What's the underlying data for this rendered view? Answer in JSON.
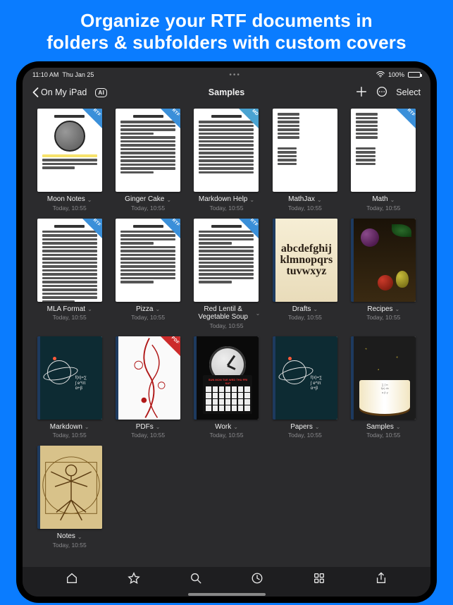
{
  "promo": {
    "line1": "Organize your RTF documents in",
    "line2": "folders & subfolders with custom covers"
  },
  "status": {
    "time": "11:10 AM",
    "date": "Thu Jan 25",
    "battery_pct": "100%"
  },
  "nav": {
    "back_label": "On My iPad",
    "ai_badge": "AI",
    "title": "Samples",
    "select_label": "Select"
  },
  "tags": {
    "rtf": "RTF",
    "md": "MD",
    "pdf": "PDF"
  },
  "items": [
    {
      "title": "Moon Notes",
      "subtitle": "Today, 10:55",
      "tag": "rtf",
      "thumb": "moon"
    },
    {
      "title": "Ginger Cake",
      "subtitle": "Today, 10:55",
      "tag": "rtf",
      "thumb": "form"
    },
    {
      "title": "Markdown Help",
      "subtitle": "Today, 10:55",
      "tag": "md",
      "thumb": "text"
    },
    {
      "title": "MathJax",
      "subtitle": "Today, 10:55",
      "tag": null,
      "thumb": "sparse"
    },
    {
      "title": "Math",
      "subtitle": "Today, 10:55",
      "tag": "rtf",
      "thumb": "sparse"
    },
    {
      "title": "MLA Format",
      "subtitle": "Today, 10:55",
      "tag": "rtf",
      "thumb": "dense"
    },
    {
      "title": "Pizza",
      "subtitle": "Today, 10:55",
      "tag": "rtf",
      "thumb": "form"
    },
    {
      "title": "Red Lentil & Vegetable Soup",
      "subtitle": "Today, 10:55",
      "tag": "rtf",
      "thumb": "form"
    },
    {
      "title": "Drafts",
      "subtitle": "Today, 10:55",
      "tag": null,
      "folder": true,
      "cover": "alphabet"
    },
    {
      "title": "Recipes",
      "subtitle": "Today, 10:55",
      "tag": null,
      "folder": true,
      "cover": "still-life"
    },
    {
      "title": "Markdown",
      "subtitle": "Today, 10:55",
      "tag": null,
      "folder": true,
      "cover": "dark-math"
    },
    {
      "title": "PDFs",
      "subtitle": "Today, 10:55",
      "tag": "pdf",
      "folder": true,
      "cover": "red-swirl"
    },
    {
      "title": "Work",
      "subtitle": "Today, 10:55",
      "tag": null,
      "folder": true,
      "cover": "work-clock"
    },
    {
      "title": "Papers",
      "subtitle": "Today, 10:55",
      "tag": null,
      "folder": true,
      "cover": "dark-math"
    },
    {
      "title": "Samples",
      "subtitle": "Today, 10:55",
      "tag": null,
      "folder": true,
      "cover": "samples-book"
    },
    {
      "title": "Notes",
      "subtitle": "Today, 10:55",
      "tag": null,
      "folder": true,
      "cover": "vitruvian"
    }
  ],
  "alphabet_cover_text": "abcdefghijklmnopqrstuvwxyz",
  "tabs": [
    "home",
    "favorites",
    "search",
    "recent",
    "browse",
    "share"
  ]
}
